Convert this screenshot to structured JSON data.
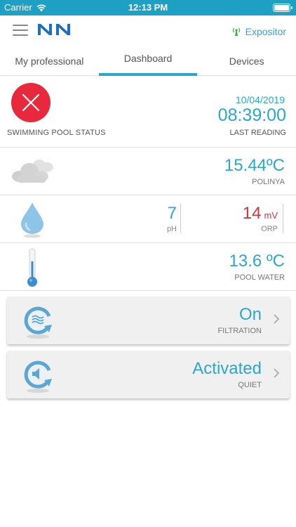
{
  "status_bar": {
    "carrier": "Carrier",
    "time": "12:13 PM"
  },
  "header": {
    "site_name": "Expositor",
    "icons": [
      "menu-icon",
      "logo",
      "signal-tower-icon"
    ]
  },
  "tabs": [
    {
      "label": "My professional",
      "active": false
    },
    {
      "label": "Dashboard",
      "active": true
    },
    {
      "label": "Devices",
      "active": false
    }
  ],
  "pool_status": {
    "label": "SWIMMING POOL STATUS",
    "state_icon": "error-x-icon",
    "date": "10/04/2019",
    "time": "08:39:00",
    "reading_label": "LAST READING"
  },
  "weather": {
    "icon": "cloud-icon",
    "temperature": "15.44ºC",
    "location": "POLINYA"
  },
  "chemistry": {
    "icon": "water-drop-icon",
    "ph_value": "7",
    "ph_label": "pH",
    "orp_value": "14",
    "orp_unit": "mV",
    "orp_label": "ORP"
  },
  "water": {
    "icon": "thermometer-icon",
    "temperature": "13.6 ºC",
    "label": "POOL WATER"
  },
  "filtration": {
    "icon": "filtration-icon",
    "value": "On",
    "label": "FILTRATION"
  },
  "quiet": {
    "icon": "quiet-mode-icon",
    "value": "Activated",
    "label": "QUIET"
  },
  "colors": {
    "accent": "#29a8cf",
    "status_bar": "#1e9fc4",
    "error": "#e8283c",
    "orp": "#c6383c"
  }
}
